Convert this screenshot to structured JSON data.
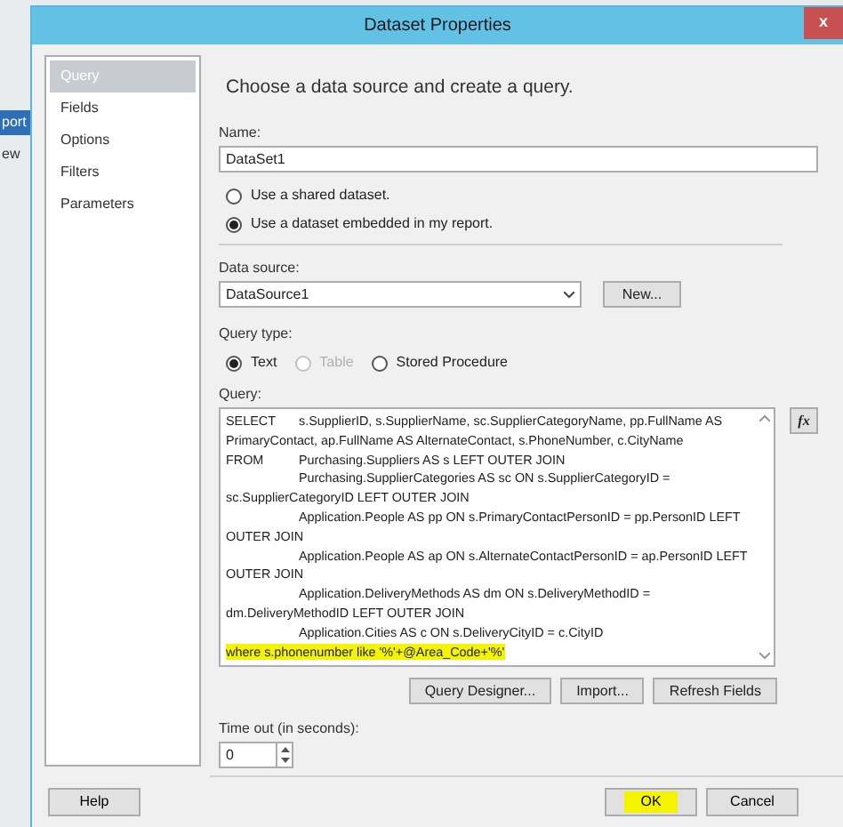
{
  "background": {
    "items": [
      {
        "text": "port",
        "selected": true
      },
      {
        "text": "ew",
        "selected": false
      }
    ]
  },
  "window": {
    "title": "Dataset Properties",
    "close": "x"
  },
  "sidebar": {
    "items": [
      {
        "label": "Query",
        "selected": true
      },
      {
        "label": "Fields",
        "selected": false
      },
      {
        "label": "Options",
        "selected": false
      },
      {
        "label": "Filters",
        "selected": false
      },
      {
        "label": "Parameters",
        "selected": false
      }
    ]
  },
  "heading": "Choose a data source and create a query.",
  "name": {
    "label": "Name:",
    "value": "DataSet1"
  },
  "dataset_options": [
    {
      "label": "Use a shared dataset.",
      "selected": false
    },
    {
      "label": "Use a dataset embedded in my report.",
      "selected": true
    }
  ],
  "data_source": {
    "label": "Data source:",
    "value": "DataSource1",
    "button": "New..."
  },
  "query_type": {
    "label": "Query type:",
    "options": [
      {
        "label": "Text",
        "selected": true,
        "disabled": false
      },
      {
        "label": "Table",
        "selected": false,
        "disabled": true
      },
      {
        "label": "Stored Procedure",
        "selected": false,
        "disabled": false
      }
    ]
  },
  "query": {
    "label": "Query:",
    "function_button": "fx",
    "lines": [
      {
        "keyword": "SELECT",
        "text": "s.SupplierID, s.SupplierName, sc.SupplierCategoryName, pp.FullName AS",
        "indented": false,
        "highlighted": false
      },
      {
        "text": "PrimaryContact, ap.FullName AS AlternateContact, s.PhoneNumber, c.CityName",
        "indented": false,
        "highlighted": false
      },
      {
        "keyword": "FROM",
        "text": "Purchasing.Suppliers AS s LEFT OUTER JOIN",
        "indented": false,
        "highlighted": false
      },
      {
        "text": "Purchasing.SupplierCategories AS sc ON s.SupplierCategoryID =",
        "indented": true,
        "highlighted": false
      },
      {
        "text": "sc.SupplierCategoryID LEFT OUTER JOIN",
        "indented": false,
        "highlighted": false
      },
      {
        "text": "Application.People AS pp ON s.PrimaryContactPersonID = pp.PersonID LEFT",
        "indented": true,
        "highlighted": false
      },
      {
        "text": "OUTER JOIN",
        "indented": false,
        "highlighted": false
      },
      {
        "text": "Application.People AS ap ON s.AlternateContactPersonID = ap.PersonID LEFT",
        "indented": true,
        "highlighted": false
      },
      {
        "text": "OUTER JOIN",
        "indented": false,
        "highlighted": false
      },
      {
        "text": "Application.DeliveryMethods AS dm ON s.DeliveryMethodID =",
        "indented": true,
        "highlighted": false
      },
      {
        "text": "dm.DeliveryMethodID LEFT OUTER JOIN",
        "indented": false,
        "highlighted": false
      },
      {
        "text": "Application.Cities AS c ON s.DeliveryCityID = c.CityID",
        "indented": true,
        "highlighted": false
      },
      {
        "text": "where s.phonenumber like '%'+@Area_Code+'%'",
        "indented": false,
        "highlighted": true
      }
    ]
  },
  "query_buttons": [
    "Query Designer...",
    "Import...",
    "Refresh Fields"
  ],
  "timeout": {
    "label": "Time out (in seconds):",
    "value": "0"
  },
  "footer": {
    "left": [
      {
        "label": "Help",
        "highlighted": false
      }
    ],
    "right": [
      {
        "label": "OK",
        "highlighted": true
      },
      {
        "label": "Cancel",
        "highlighted": false
      }
    ]
  }
}
